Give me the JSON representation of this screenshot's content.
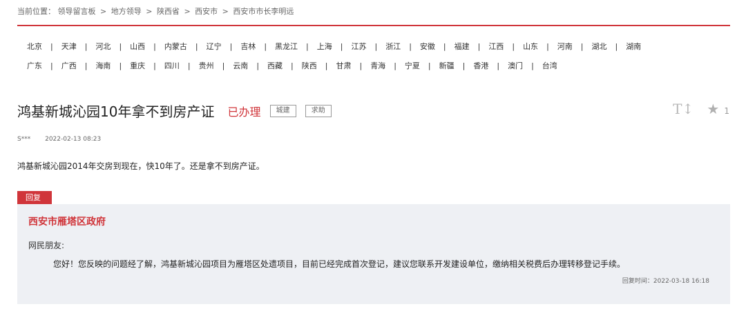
{
  "breadcrumb": {
    "prefix": "当前位置：",
    "items": [
      "领导留言板",
      "地方领导",
      "陕西省",
      "西安市",
      "西安市市长李明远"
    ],
    "separator": ">"
  },
  "regions": {
    "row1": [
      "北京",
      "天津",
      "河北",
      "山西",
      "内蒙古",
      "辽宁",
      "吉林",
      "黑龙江",
      "上海",
      "江苏",
      "浙江",
      "安徽",
      "福建",
      "江西",
      "山东",
      "河南",
      "湖北",
      "湖南"
    ],
    "row2": [
      "广东",
      "广西",
      "海南",
      "重庆",
      "四川",
      "贵州",
      "云南",
      "西藏",
      "陕西",
      "甘肃",
      "青海",
      "宁夏",
      "新疆",
      "香港",
      "澳门",
      "台湾"
    ],
    "divider": "|"
  },
  "message": {
    "title": "鸿基新城沁园10年拿不到房产证",
    "status": "已办理",
    "tags": [
      "城建",
      "求助"
    ],
    "author": "S***",
    "date": "2022-02-13 08:23",
    "content": "鸿基新城沁园2014年交房到现在，快10年了。还是拿不到房产证。",
    "font_tool_label": "T↕",
    "star_icon": "★",
    "favorites_count": "1"
  },
  "reply": {
    "badge": "回复",
    "department": "西安市雁塔区政府",
    "greeting": "网民朋友:",
    "text": "您好！您反映的问题经了解，鸿基新城沁园项目为雁塔区处遗项目，目前已经完成首次登记，建议您联系开发建设单位，缴纳相关税费后办理转移登记手续。",
    "time": "回复时间：2022-03-18 16:18"
  },
  "colors": {
    "accent": "#d0353a",
    "reply_bg": "#eef0f4"
  }
}
